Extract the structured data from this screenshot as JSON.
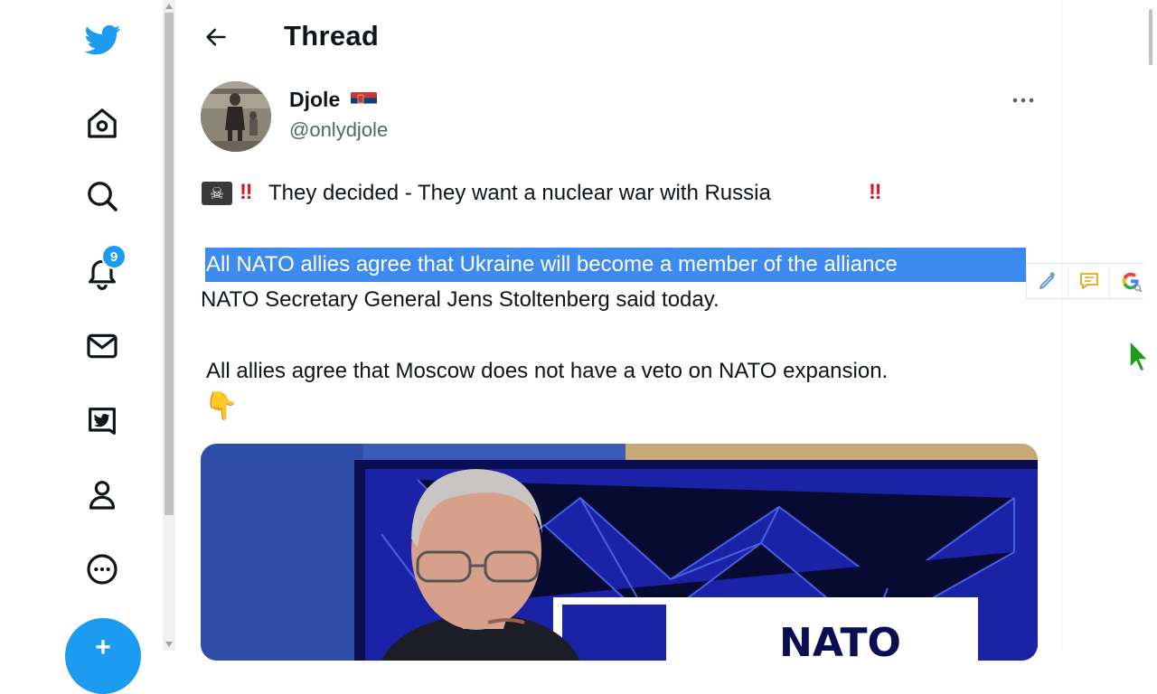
{
  "header": {
    "title": "Thread"
  },
  "sidebar": {
    "notification_count": "9"
  },
  "tweet": {
    "author_name": "Djole",
    "handle": "@onlydjole",
    "line1": "They decided - They want a nuclear war with Russia",
    "line2_highlighted": "All NATO allies agree that Ukraine will become a member of the alliance",
    "line3": "NATO Secretary General Jens Stoltenberg said today.",
    "line4": "All allies agree that Moscow does not have a veto on NATO expansion.",
    "emoji_skull": "☠",
    "emoji_bangbang": "‼",
    "emoji_pointer": "👇",
    "media_text": "NATO"
  },
  "icons": {
    "logo": "twitter-bird-icon",
    "home": "home-icon",
    "explore": "search-icon",
    "notifications": "bell-icon",
    "messages": "envelope-icon",
    "verified": "twitter-blue-icon",
    "profile": "person-icon",
    "more": "more-circle-icon"
  },
  "colors": {
    "accent": "#1d9bf0",
    "highlight": "#3d8bef",
    "secondary_text": "#536471",
    "emoji_red": "#d81b2b"
  }
}
